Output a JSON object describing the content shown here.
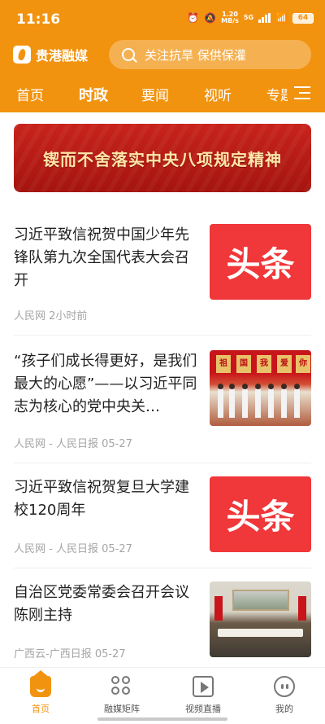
{
  "status_bar": {
    "time": "11:16",
    "net_speed": "1.20",
    "net_unit": "MB/s",
    "net_type": "5G",
    "battery": "64"
  },
  "app": {
    "name": "贵港融媒",
    "accent": "#f2930f"
  },
  "search": {
    "placeholder": "关注抗旱 保供保灌"
  },
  "tabs": [
    {
      "label": "首页"
    },
    {
      "label": "时政",
      "active": true
    },
    {
      "label": "要闻"
    },
    {
      "label": "视听"
    },
    {
      "label": "专题"
    }
  ],
  "banner": {
    "text": "锲而不舍落实中央八项规定精神"
  },
  "news": [
    {
      "title": "习近平致信祝贺中国少年先锋队第九次全国代表大会召开",
      "meta": "人民网  2小时前",
      "thumb_text": "头条"
    },
    {
      "title": "“孩子们成长得更好，是我们最大的心愿”——以习近平同志为核心的党中央关…",
      "meta": "人民网 - 人民日报  05-27",
      "thumb_flags": [
        "祖",
        "国",
        "我",
        "爱",
        "你"
      ]
    },
    {
      "title": "习近平致信祝贺复旦大学建校120周年",
      "meta": "人民网 - 人民日报  05-27",
      "thumb_text": "头条"
    },
    {
      "title": "自治区党委常委会召开会议 陈刚主持",
      "meta": "广西云-广西日报  05-27"
    }
  ],
  "bottom_nav": [
    {
      "label": "首页",
      "icon": "home-icon",
      "active": true
    },
    {
      "label": "融媒矩阵",
      "icon": "matrix-icon"
    },
    {
      "label": "视频直播",
      "icon": "video-live-icon"
    },
    {
      "label": "我的",
      "icon": "profile-icon"
    }
  ]
}
